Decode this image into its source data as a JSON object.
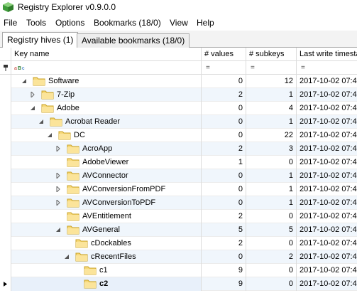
{
  "window": {
    "title": "Registry Explorer v0.9.0.0"
  },
  "menu": [
    "File",
    "Tools",
    "Options",
    "Bookmarks (18/0)",
    "View",
    "Help"
  ],
  "tabs": [
    {
      "label": "Registry hives (1)",
      "active": true
    },
    {
      "label": "Available bookmarks (18/0)",
      "active": false
    }
  ],
  "columns": {
    "key_name": "Key name",
    "values": "# values",
    "subkeys": "# subkeys",
    "last_write": "Last write timesta"
  },
  "filter": {
    "pin_icon": "pin-icon",
    "text_filter_icon": "abc-filter-icon",
    "eq_symbol": "="
  },
  "rows": [
    {
      "name": "Software",
      "level": 2,
      "expander": "expanded",
      "values": "0",
      "subkeys": "12",
      "timestamp": "2017-10-02 07:4",
      "selected": false,
      "bold": false
    },
    {
      "name": "7-Zip",
      "level": 3,
      "expander": "collapsed",
      "values": "2",
      "subkeys": "1",
      "timestamp": "2017-10-02 07:4",
      "selected": false,
      "bold": false
    },
    {
      "name": "Adobe",
      "level": 3,
      "expander": "expanded",
      "values": "0",
      "subkeys": "4",
      "timestamp": "2017-10-02 07:4",
      "selected": false,
      "bold": false
    },
    {
      "name": "Acrobat Reader",
      "level": 4,
      "expander": "expanded",
      "values": "0",
      "subkeys": "1",
      "timestamp": "2017-10-02 07:4",
      "selected": false,
      "bold": false
    },
    {
      "name": "DC",
      "level": 5,
      "expander": "expanded",
      "values": "0",
      "subkeys": "22",
      "timestamp": "2017-10-02 07:4",
      "selected": false,
      "bold": false
    },
    {
      "name": "AcroApp",
      "level": 6,
      "expander": "collapsed",
      "values": "2",
      "subkeys": "3",
      "timestamp": "2017-10-02 07:4",
      "selected": false,
      "bold": false
    },
    {
      "name": "AdobeViewer",
      "level": 6,
      "expander": "none",
      "values": "1",
      "subkeys": "0",
      "timestamp": "2017-10-02 07:4",
      "selected": false,
      "bold": false
    },
    {
      "name": "AVConnector",
      "level": 6,
      "expander": "collapsed",
      "values": "0",
      "subkeys": "1",
      "timestamp": "2017-10-02 07:4",
      "selected": false,
      "bold": false
    },
    {
      "name": "AVConversionFromPDF",
      "level": 6,
      "expander": "collapsed",
      "values": "0",
      "subkeys": "1",
      "timestamp": "2017-10-02 07:4",
      "selected": false,
      "bold": false
    },
    {
      "name": "AVConversionToPDF",
      "level": 6,
      "expander": "collapsed",
      "values": "0",
      "subkeys": "1",
      "timestamp": "2017-10-02 07:4",
      "selected": false,
      "bold": false
    },
    {
      "name": "AVEntitlement",
      "level": 6,
      "expander": "none",
      "values": "2",
      "subkeys": "0",
      "timestamp": "2017-10-02 07:4",
      "selected": false,
      "bold": false
    },
    {
      "name": "AVGeneral",
      "level": 6,
      "expander": "expanded",
      "values": "5",
      "subkeys": "5",
      "timestamp": "2017-10-02 07:4",
      "selected": false,
      "bold": false
    },
    {
      "name": "cDockables",
      "level": 7,
      "expander": "none",
      "values": "2",
      "subkeys": "0",
      "timestamp": "2017-10-02 07:4",
      "selected": false,
      "bold": false
    },
    {
      "name": "cRecentFiles",
      "level": 7,
      "expander": "expanded",
      "values": "0",
      "subkeys": "2",
      "timestamp": "2017-10-02 07:4",
      "selected": false,
      "bold": false
    },
    {
      "name": "c1",
      "level": 8,
      "expander": "none",
      "values": "9",
      "subkeys": "0",
      "timestamp": "2017-10-02 07:4",
      "selected": false,
      "bold": false
    },
    {
      "name": "c2",
      "level": 8,
      "expander": "none",
      "values": "9",
      "subkeys": "0",
      "timestamp": "2017-10-02 07:4",
      "selected": true,
      "bold": true
    }
  ],
  "colors": {
    "folder_fill": "#f7d97a",
    "folder_edge": "#c9a227",
    "row_alt": "#f0f6fc",
    "app_icon": "#4caf50"
  }
}
